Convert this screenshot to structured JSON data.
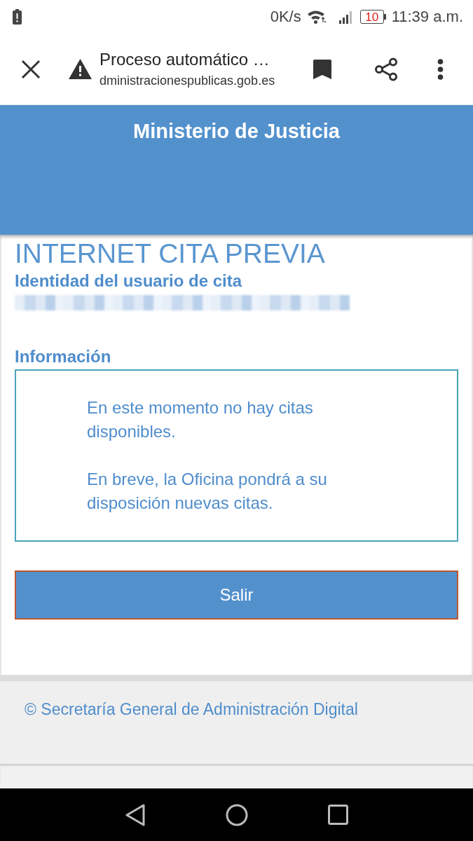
{
  "status_bar": {
    "network_speed": "0K/s",
    "battery_level": "10",
    "time": "11:39 a.m."
  },
  "browser_toolbar": {
    "title": "Proceso automático …",
    "url": "dministracionespublicas.gob.es"
  },
  "header": {
    "title": "Ministerio de Justicia"
  },
  "page": {
    "heading": "INTERNET CITA PREVIA",
    "identity_label": "Identidad del usuario de cita",
    "identity_redacted": true,
    "info_label": "Información",
    "info_paragraphs": [
      "En este momento no hay citas disponibles.",
      "En breve, la Oficina pondrá a su disposición nuevas citas."
    ],
    "exit_button": "Salir"
  },
  "footer": {
    "text": "© Secretaría General de Administración Digital"
  }
}
